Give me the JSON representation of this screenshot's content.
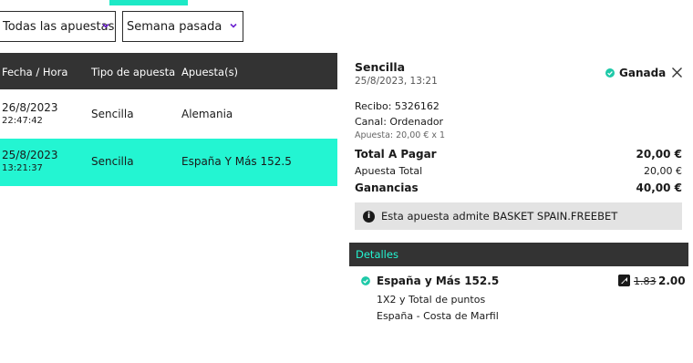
{
  "filters": {
    "bet_type": "Todas las apuestas",
    "period": "Semana pasada"
  },
  "table": {
    "headers": [
      "Fecha / Hora",
      "Tipo de apuesta",
      "Apuesta(s)"
    ],
    "rows": [
      {
        "date": "26/8/2023",
        "time": "22:47:42",
        "type": "Sencilla",
        "bet": "Alemania"
      },
      {
        "date": "25/8/2023",
        "time": "13:21:37",
        "type": "Sencilla",
        "bet": "España Y Más 152.5"
      }
    ]
  },
  "detail": {
    "title": "Sencilla",
    "datetime": "25/8/2023, 13:21",
    "status": "Ganada",
    "receipt": "Recibo: 5326162",
    "channel": "Canal: Ordenador",
    "stake_note": "Apuesta: 20,00 € x 1",
    "total_label": "Total A Pagar",
    "total_value": "20,00 €",
    "stake_label": "Apuesta Total",
    "stake_value": "20,00 €",
    "winnings_label": "Ganancias",
    "winnings_value": "40,00 €",
    "info_text": "Esta apuesta admite BASKET SPAIN.FREEBET",
    "details_heading": "Detalles",
    "selection": {
      "name": "España y Más 152.5",
      "market": "1X2 y Total de puntos",
      "event": "España - Costa de Marfil",
      "old_odds": "1.83",
      "new_odds": "2.00"
    }
  },
  "colors": {
    "accent": "#23f5d2",
    "header_bg": "#333333",
    "win_green": "#1ec9a8",
    "caret": "#6a1fd0"
  },
  "icons": {
    "status": "check-circle-icon",
    "close": "close-icon",
    "info": "info-icon",
    "boost": "boost-arrow-icon",
    "caret": "chevron-down-icon"
  }
}
